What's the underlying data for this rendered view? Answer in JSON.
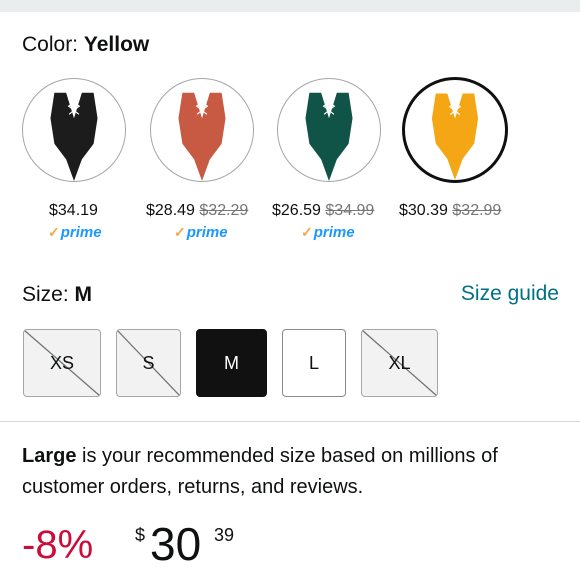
{
  "color": {
    "label": "Color:",
    "value": "Yellow"
  },
  "swatches": [
    {
      "name": "Black",
      "color": "#1c1c1c",
      "price": "$34.19",
      "list_price": "",
      "prime": true,
      "selected": false
    },
    {
      "name": "Red",
      "color": "#c85a44",
      "price": "$28.49",
      "list_price": "$32.29",
      "prime": true,
      "selected": false
    },
    {
      "name": "Green",
      "color": "#0f5446",
      "price": "$26.59",
      "list_price": "$34.99",
      "prime": true,
      "selected": false
    },
    {
      "name": "Yellow",
      "color": "#f5a614",
      "price": "$30.39",
      "list_price": "$32.99",
      "prime": false,
      "selected": true
    }
  ],
  "prime_label": "prime",
  "size": {
    "label": "Size:",
    "value": "M",
    "guide_label": "Size guide"
  },
  "sizes": [
    {
      "label": "XS",
      "state": "unavailable"
    },
    {
      "label": "S",
      "state": "unavailable"
    },
    {
      "label": "M",
      "state": "selected"
    },
    {
      "label": "L",
      "state": "available"
    },
    {
      "label": "XL",
      "state": "unavailable"
    }
  ],
  "recommendation": {
    "size": "Large",
    "text": " is your recommended size based on millions of customer orders, returns, and reviews."
  },
  "price": {
    "discount": "-8%",
    "currency": "$",
    "whole": "30",
    "fraction": "39"
  }
}
